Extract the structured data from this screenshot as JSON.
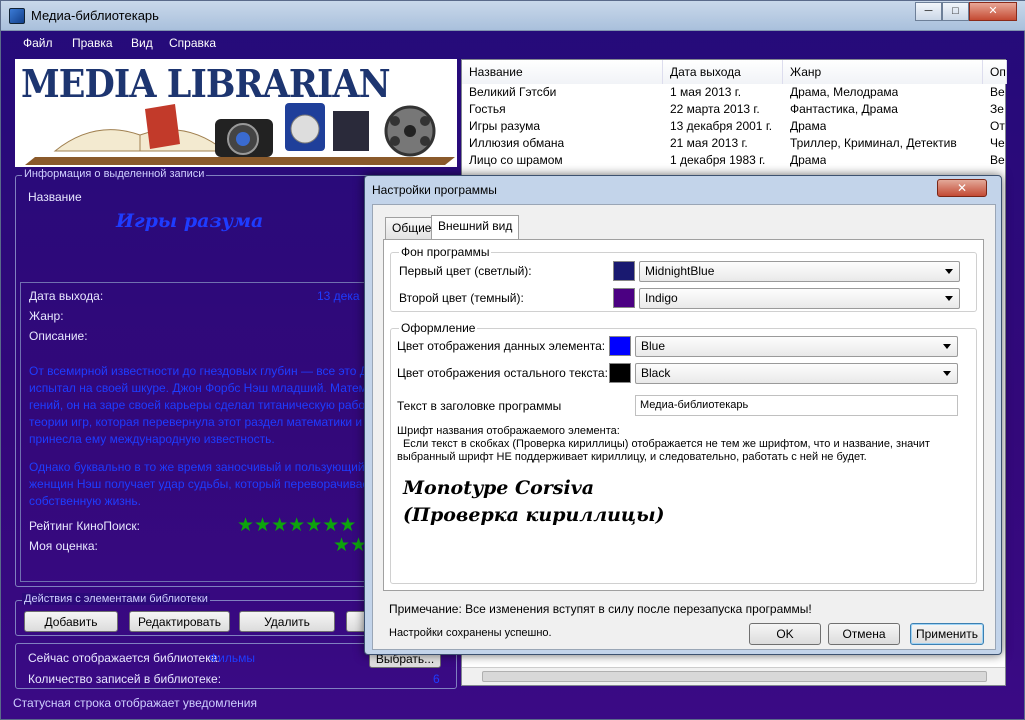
{
  "window": {
    "title": "Медиа-библиотекарь",
    "buttons": {
      "minimize": "─",
      "maximize": "□",
      "close": "✕"
    }
  },
  "menu": [
    "Файл",
    "Правка",
    "Вид",
    "Справка"
  ],
  "banner": {
    "logo_text": "MEDIA LIBRARIAN"
  },
  "info": {
    "group_label": "Информация о выделенной записи",
    "name_label": "Название",
    "name_value": "Игры разума",
    "release_label": "Дата выхода:",
    "release_value": "13 дека",
    "genre_label": "Жанр:",
    "description_label": "Описание:",
    "description_p1": "От всемирной известности до гнездовых глубин — все это Джон Нэш испытал на своей шкуре. Джон Форбс Нэш младший. Математический гений, он на заре своей карьеры сделал титаническую работу в области теории игр, которая перевернула этот раздел математики и практически принесла ему международную известность.",
    "description_p2": "Однако буквально в то же время заносчивый и пользующийся успехом у женщин Нэш получает удар судьбы, который переворачивает уже его собственную жизнь.",
    "kp_rating_label": "Рейтинг КиноПоиск:",
    "my_rating_label": "Моя оценка:",
    "kp_stars": 7,
    "my_stars": 2
  },
  "actions": {
    "group_label": "Действия с элементами библиотеки",
    "add": "Добавить",
    "edit": "Редактировать",
    "delete": "Удалить"
  },
  "library": {
    "current_label": "Сейчас отображается библиотека:",
    "current_value": "Фильмы",
    "select_button": "Выбрать...",
    "count_label": "Количество записей в библиотеке:",
    "count_value": "6"
  },
  "status_bar": "Статусная строка отображает уведомления",
  "table": {
    "columns": [
      "Название",
      "Дата выхода",
      "Жанр",
      "Оп"
    ],
    "rows": [
      [
        "Великий Гэтсби",
        "1 мая 2013 г.",
        "Драма, Мелодрама",
        "Ве"
      ],
      [
        "Гостья",
        "22 марта 2013 г.",
        "Фантастика, Драма",
        "Зе"
      ],
      [
        "Игры разума",
        "13 декабря 2001 г.",
        "Драма",
        "От"
      ],
      [
        "Иллюзия обмана",
        "21 мая 2013 г.",
        "Триллер, Криминал, Детектив",
        "Че"
      ],
      [
        "Лицо со шрамом",
        "1 декабря 1983 г.",
        "Драма",
        "Ве"
      ]
    ]
  },
  "dialog": {
    "title": "Настройки программы",
    "close": "✕",
    "tabs": [
      "Общие",
      "Внешний вид"
    ],
    "bg_group": "Фон программы",
    "first_color_label": "Первый цвет (светлый):",
    "first_color_value": "MidnightBlue",
    "first_color_hex": "#191970",
    "second_color_label": "Второй цвет (темный):",
    "second_color_value": "Indigo",
    "second_color_hex": "#4b0082",
    "design_group": "Оформление",
    "data_color_label": "Цвет отображения данных элемента:",
    "data_color_value": "Blue",
    "data_color_hex": "#0000ff",
    "text_color_label": "Цвет отображения остального текста:",
    "text_color_value": "Black",
    "text_color_hex": "#000000",
    "title_text_label": "Текст в заголовке программы",
    "title_text_value": "Медиа-библиотекарь",
    "font_label": "Шрифт названия отображаемого элемента:",
    "font_hint_1": "Если текст в скобках (Проверка кириллицы) отображается не тем же шрифтом, что и название, значит",
    "font_hint_2": "выбранный шрифт НЕ поддерживает кириллицу, и следовательно, работать с ней не будет.",
    "font_sample_1": "Monotype Corsiva",
    "font_sample_2": "(Проверка кириллицы)",
    "note": "Примечание: Все изменения вступят в силу после перезапуска программы!",
    "status": "Настройки сохранены успешно.",
    "ok": "OK",
    "cancel": "Отмена",
    "apply": "Применить"
  }
}
